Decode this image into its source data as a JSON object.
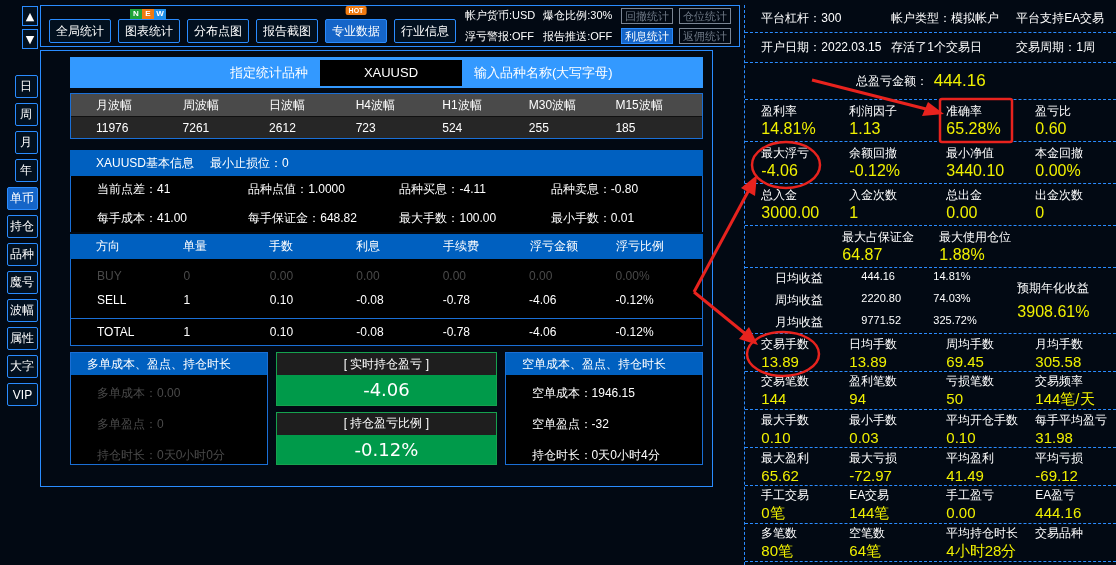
{
  "nav_arrows": [
    "▲",
    "▼"
  ],
  "period_buttons": [
    {
      "label": "日",
      "selected": false
    },
    {
      "label": "周",
      "selected": false
    },
    {
      "label": "月",
      "selected": false
    },
    {
      "label": "年",
      "selected": false
    }
  ],
  "mode_buttons": [
    {
      "label": "单币",
      "selected": true
    },
    {
      "label": "持仓",
      "selected": false
    },
    {
      "label": "品种",
      "selected": false
    },
    {
      "label": "魔号",
      "selected": false
    },
    {
      "label": "波幅",
      "selected": false
    },
    {
      "label": "属性",
      "selected": false
    },
    {
      "label": "大字",
      "selected": false
    },
    {
      "label": "VIP",
      "selected": false
    }
  ],
  "toolbar": {
    "buttons": [
      {
        "label": "全局统计",
        "selected": false
      },
      {
        "label": "图表统计",
        "selected": false,
        "badge_letters": [
          {
            "letter": "N",
            "color": "#1fa33a"
          },
          {
            "letter": "E",
            "color": "#f07a10"
          },
          {
            "letter": "W",
            "color": "#1f8fe8"
          }
        ]
      },
      {
        "label": "分布点图",
        "selected": false
      },
      {
        "label": "报告截图",
        "selected": false
      },
      {
        "label": "专业数据",
        "selected": true,
        "badge": "HOT"
      },
      {
        "label": "行业信息",
        "selected": false
      }
    ],
    "status": [
      "帐户货币:USD",
      "爆仓比例:30%",
      "浮亏警报:OFF",
      "报告推送:OFF"
    ],
    "stat_buttons": [
      {
        "label": "回撤统计",
        "active": false
      },
      {
        "label": "仓位统计",
        "active": false
      },
      {
        "label": "利息统计",
        "active": true
      },
      {
        "label": "返佣统计",
        "active": false
      }
    ]
  },
  "symbol_bar": {
    "label": "指定统计品种",
    "value": "XAUUSD",
    "hint_text": "输入品种名称(大写字母)"
  },
  "volatility": {
    "columns": [
      "月波幅",
      "周波幅",
      "日波幅",
      "H4波幅",
      "H1波幅",
      "M30波幅",
      "M15波幅"
    ],
    "values": [
      "11976",
      "7261",
      "2612",
      "723",
      "524",
      "255",
      "185"
    ]
  },
  "basic_info": {
    "title": "XAUUSD基本信息",
    "min_stop": "最小止损位：0",
    "items": [
      "当前点差：41",
      "品种点值：1.0000",
      "品种买息：-4.11",
      "品种卖息：-0.80",
      "每手成本：41.00",
      "每手保证金：648.82",
      "最大手数：100.00",
      "最小手数：0.01"
    ]
  },
  "positions": {
    "columns": [
      "方向",
      "单量",
      "手数",
      "利息",
      "手续费",
      "浮亏金额",
      "浮亏比例"
    ],
    "rows": [
      {
        "kind": "order",
        "dimmed": true,
        "cells": [
          "BUY",
          "0",
          "0.00",
          "0.00",
          "0.00",
          "0.00",
          "0.00%"
        ]
      },
      {
        "kind": "order",
        "dimmed": false,
        "cells": [
          "SELL",
          "1",
          "0.10",
          "-0.08",
          "-0.78",
          "-4.06",
          "-0.12%"
        ]
      },
      {
        "kind": "total",
        "dimmed": false,
        "cells": [
          "TOTAL",
          "1",
          "0.10",
          "-0.08",
          "-0.78",
          "-4.06",
          "-0.12%"
        ]
      }
    ]
  },
  "long_box": {
    "title": "多单成本、盈点、持仓时长",
    "dimmed": true,
    "lines": [
      "多单成本：0.00",
      "多单盈点：0",
      "持仓时长：0天0小时0分"
    ]
  },
  "realtime": [
    {
      "title": "[ 实时持仓盈亏 ]",
      "value": "-4.06"
    },
    {
      "title": "[ 持仓盈亏比例 ]",
      "value": "-0.12%"
    }
  ],
  "short_box": {
    "title": "空单成本、盈点、持仓时长",
    "dimmed": false,
    "lines": [
      "空单成本：1946.15",
      "空单盈点：-32",
      "持仓时长：0天0小时4分"
    ]
  },
  "account_rows": [
    [
      "平台杠杆：300",
      "帐户类型：模拟帐户",
      "平台支持EA交易"
    ],
    [
      "开户日期：2022.03.15",
      "存活了1个交易日",
      "交易周期：1周"
    ]
  ],
  "total_pnl": {
    "label": "总盈亏金额：",
    "value": "444.16"
  },
  "stat_rows_top": [
    [
      {
        "label": "盈利率",
        "value": "14.81%"
      },
      {
        "label": "利润因子",
        "value": "1.13"
      },
      {
        "label": "准确率",
        "value": "65.28%"
      },
      {
        "label": "盈亏比",
        "value": "0.60"
      }
    ],
    [
      {
        "label": "最大浮亏",
        "value": "-4.06"
      },
      {
        "label": "余额回撤",
        "value": "-0.12%"
      },
      {
        "label": "最小净值",
        "value": "3440.10"
      },
      {
        "label": "本金回撤",
        "value": "0.00%"
      }
    ],
    [
      {
        "label": "总入金",
        "value": "3000.00"
      },
      {
        "label": "入金次数",
        "value": "1"
      },
      {
        "label": "总出金",
        "value": "0.00"
      },
      {
        "label": "出金次数",
        "value": "0"
      }
    ],
    [
      {
        "label": "最大占保证金",
        "value": "64.87"
      },
      {
        "label": "最大使用仓位",
        "value": "1.88%"
      }
    ]
  ],
  "averages": {
    "rows": [
      {
        "label": "日均收益",
        "amount": "444.16",
        "percent": "14.81%"
      },
      {
        "label": "周均收益",
        "amount": "2220.80",
        "percent": "74.03%"
      },
      {
        "label": "月均收益",
        "amount": "9771.52",
        "percent": "325.72%"
      }
    ],
    "annual_label": "预期年化收益",
    "annual_value": "3908.61%"
  },
  "stat_rows_bottom": [
    [
      {
        "label": "交易手数",
        "value": "13.89"
      },
      {
        "label": "日均手数",
        "value": "13.89"
      },
      {
        "label": "周均手数",
        "value": "69.45"
      },
      {
        "label": "月均手数",
        "value": "305.58"
      }
    ],
    [
      {
        "label": "交易笔数",
        "value": "144"
      },
      {
        "label": "盈利笔数",
        "value": "94"
      },
      {
        "label": "亏损笔数",
        "value": "50"
      },
      {
        "label": "交易频率",
        "value": "144笔/天"
      }
    ],
    [
      {
        "label": "最大手数",
        "value": "0.10"
      },
      {
        "label": "最小手数",
        "value": "0.03"
      },
      {
        "label": "平均开仓手数",
        "value": "0.10"
      },
      {
        "label": "每手平均盈亏",
        "value": "31.98"
      }
    ],
    [
      {
        "label": "最大盈利",
        "value": "65.62"
      },
      {
        "label": "最大亏损",
        "value": "-72.97"
      },
      {
        "label": "平均盈利",
        "value": "41.49"
      },
      {
        "label": "平均亏损",
        "value": "-69.12"
      }
    ],
    [
      {
        "label": "手工交易",
        "value": "0笔"
      },
      {
        "label": "EA交易",
        "value": "144笔"
      },
      {
        "label": "手工盈亏",
        "value": "0.00"
      },
      {
        "label": "EA盈亏",
        "value": "444.16"
      }
    ],
    [
      {
        "label": "多笔数",
        "value": "80笔"
      },
      {
        "label": "空笔数",
        "value": "64笔"
      },
      {
        "label": "平均持仓时长",
        "value": "4小时28分"
      },
      {
        "label": "交易品种"
      }
    ]
  ]
}
